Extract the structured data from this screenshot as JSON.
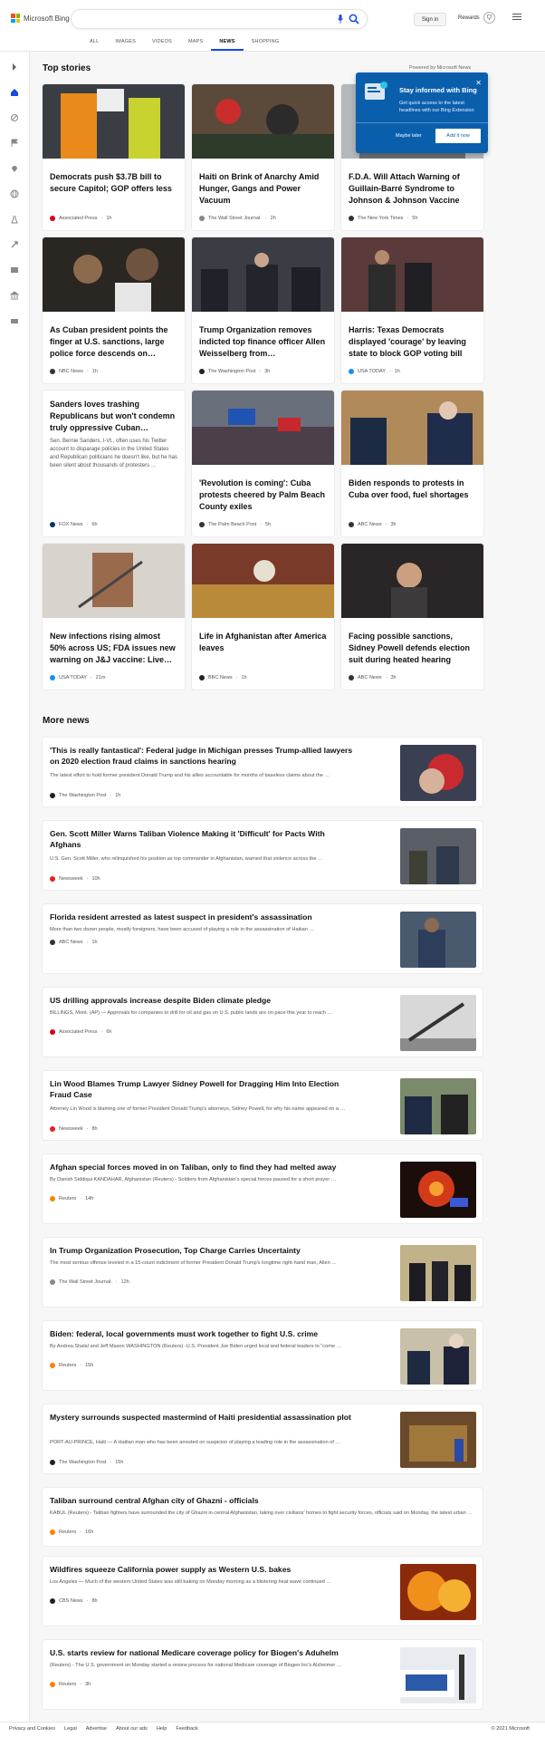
{
  "header": {
    "logo_text": "Microsoft Bing",
    "search_value": "",
    "signin_label": "Sign in",
    "rewards_label": "Rewards",
    "tabs": [
      {
        "label": "ALL"
      },
      {
        "label": "IMAGES"
      },
      {
        "label": "VIDEOS"
      },
      {
        "label": "MAPS"
      },
      {
        "label": "NEWS"
      },
      {
        "label": "SHOPPING"
      }
    ],
    "active_tab": "NEWS",
    "logo_colors": [
      "#f25022",
      "#7fba00",
      "#00a4ef",
      "#ffb900"
    ]
  },
  "rail_icons": [
    "arrow-right-icon",
    "home-icon",
    "sports-icon",
    "flag-icon",
    "location-pin-icon",
    "globe-icon",
    "science-icon",
    "rocket-icon",
    "tv-icon",
    "bank-icon",
    "card-icon"
  ],
  "top_stories": {
    "title": "Top stories",
    "powered_by": "Powered by Microsoft News",
    "cards": [
      {
        "title": "Democrats push $3.7B bill to secure Capitol; GOP offers less",
        "snippet": "",
        "source": "Associated Press",
        "age": "1h",
        "src_color": "#d6001c"
      },
      {
        "title": "Haiti on Brink of Anarchy Amid Hunger, Gangs and Power Vacuum",
        "snippet": "",
        "source": "The Wall Street Journal.",
        "age": "2h",
        "src_color": "#888888"
      },
      {
        "title": "F.D.A. Will Attach Warning of Guillain-Barré Syndrome to Johnson & Johnson Vaccine",
        "snippet": "",
        "source": "The New York Times",
        "age": "5h",
        "src_color": "#333333"
      },
      {
        "title": "As Cuban president points the finger at U.S. sanctions, large police force descends on…",
        "snippet": "",
        "source": "NBC News",
        "age": "1h",
        "src_color": "#333333"
      },
      {
        "title": "Trump Organization removes indicted top finance officer Allen Weisselberg from…",
        "snippet": "",
        "source": "The Washington Post",
        "age": "3h",
        "src_color": "#222222"
      },
      {
        "title": "Harris: Texas Democrats displayed 'courage' by leaving state to block GOP voting bill",
        "snippet": "",
        "source": "USA TODAY",
        "age": "1h",
        "src_color": "#1a8ef0"
      },
      {
        "title": "Sanders loves trashing Republicans but won't condemn truly oppressive Cuban…",
        "snippet": "Sen. Bernie Sanders, I-Vt., often uses his Twitter account to disparage policies in the United States and Republican politicians he doesn't like, but he has been silent about thousands of protesters …",
        "source": "FOX News",
        "age": "6h",
        "src_color": "#003366"
      },
      {
        "title": "'Revolution is coming': Cuba protests cheered by Palm Beach County exiles",
        "snippet": "",
        "source": "The Palm Beach Post",
        "age": "5h",
        "src_color": "#333333"
      },
      {
        "title": "Biden responds to protests in Cuba over food, fuel shortages",
        "snippet": "",
        "source": "ABC News",
        "age": "3h",
        "src_color": "#333333"
      },
      {
        "title": "New infections rising almost 50% across US; FDA issues new warning on J&J vaccine: Live…",
        "snippet": "",
        "source": "USA TODAY",
        "age": "21m",
        "src_color": "#1a8ef0"
      },
      {
        "title": "Life in Afghanistan after America leaves",
        "snippet": "",
        "source": "BBC News",
        "age": "1h",
        "src_color": "#222222"
      },
      {
        "title": "Facing possible sanctions, Sidney Powell defends election suit during heated hearing",
        "snippet": "",
        "source": "ABC News",
        "age": "3h",
        "src_color": "#333333"
      }
    ]
  },
  "popup": {
    "title": "Stay informed with Bing",
    "text": "Get quick access to the latest headlines with our Bing Extension",
    "later_label": "Maybe later",
    "add_label": "Add it now"
  },
  "more_news": {
    "title": "More news",
    "items": [
      {
        "title": "'This is really fantastical': Federal judge in Michigan presses Trump-allied lawyers on 2020 election fraud claims in sanctions hearing",
        "snippet": "The latest effort to hold former president Donald Trump and his allies accountable for months of baseless claims about the …",
        "source": "The Washington Post",
        "age": "1h",
        "src_color": "#222222"
      },
      {
        "title": "Gen. Scott Miller Warns Taliban Violence Making it 'Difficult' for Pacts With Afghans",
        "snippet": "U.S. Gen. Scott Miller, who relinquished his position as top commander in Afghanistan, warned that violence across the …",
        "source": "Newsweek",
        "age": "10h",
        "src_color": "#e2231a"
      },
      {
        "title": "Florida resident arrested as latest suspect in president's assassination",
        "snippet": "More than two dozen people, mostly foreigners, have been accused of playing a role in the assassination of Haitian …",
        "source": "ABC News",
        "age": "1h",
        "src_color": "#333333"
      },
      {
        "title": "US drilling approvals increase despite Biden climate pledge",
        "snippet": "BILLINGS, Mont. (AP) — Approvals for companies to drill for oil and gas on U.S. public lands are on pace this year to reach …",
        "source": "Associated Press",
        "age": "6h",
        "src_color": "#d6001c"
      },
      {
        "title": "Lin Wood Blames Trump Lawyer Sidney Powell for Dragging Him Into Election Fraud Case",
        "snippet": "Attorney Lin Wood is blaming one of former President Donald Trump's attorneys, Sidney Powell, for why his name appeared on a …",
        "source": "Newsweek",
        "age": "8h",
        "src_color": "#e2231a"
      },
      {
        "title": "Afghan special forces moved in on Taliban, only to find they had melted away",
        "snippet": "By Danish Siddiqui KANDAHAR, Afghanistan (Reuters) - Soldiers from Afghanistan's special forces paused for a short prayer …",
        "source": "Reuters",
        "age": "14h",
        "src_color": "#ff8000"
      },
      {
        "title": "In Trump Organization Prosecution, Top Charge Carries Uncertainty",
        "snippet": "The most serious offense leveled in a 15-count indictment of former President Donald Trump's longtime right-hand man, Allen …",
        "source": "The Wall Street Journal.",
        "age": "12h",
        "src_color": "#888888"
      },
      {
        "title": "Biden: federal, local governments must work together to fight U.S. crime",
        "snippet": "By Andrea Shalal and Jeff Mason WASHINGTON (Reuters) -U.S. President Joe Biden urged local and federal leaders to \"come …",
        "source": "Reuters",
        "age": "15h",
        "src_color": "#ff8000"
      },
      {
        "title": "Mystery surrounds suspected mastermind of Haiti presidential assassination plot",
        "snippet": "PORT-AU-PRINCE, Haiti — A Haitian man who has been arrested on suspicion of playing a leading role in the assassination of …",
        "source": "The Washington Post",
        "age": "15h",
        "src_color": "#222222"
      },
      {
        "title": "Taliban surround central Afghan city of Ghazni - officials",
        "snippet": "KABUL (Reuters) - Taliban fighters have surrounded the city of Ghazni in central Afghanistan, taking over civilians' homes to fight security forces, officials said on Monday, the latest urban …",
        "source": "Reuters",
        "age": "16h",
        "src_color": "#ff8000"
      },
      {
        "title": "Wildfires squeeze California power supply as Western U.S. bakes",
        "snippet": "Los Angeles — Much of the western United States was still baking on Monday morning as a blistering heat wave continued …",
        "source": "CBS News",
        "age": "8h",
        "src_color": "#222222"
      },
      {
        "title": "U.S. starts review for national Medicare coverage policy for Biogen's Aduhelm",
        "snippet": "(Reuters) - The U.S. government on Monday started a review process for national Medicare coverage of Biogen Inc's Alzheimer …",
        "source": "Reuters",
        "age": "3h",
        "src_color": "#ff8000"
      }
    ]
  },
  "footer": {
    "links": [
      {
        "label": "Privacy and Cookies"
      },
      {
        "label": "Legal"
      },
      {
        "label": "Advertise"
      },
      {
        "label": "About our ads"
      },
      {
        "label": "Help"
      },
      {
        "label": "Feedback"
      }
    ],
    "copyright": "© 2021 Microsoft"
  }
}
